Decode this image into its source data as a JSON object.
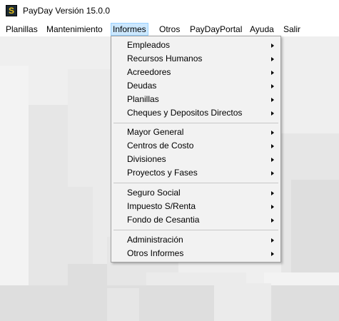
{
  "window": {
    "title": "PayDay Versión 15.0.0",
    "icon": "payday-logo-icon"
  },
  "menubar": {
    "items": [
      {
        "label": "Planillas"
      },
      {
        "label": "Mantenimiento"
      },
      {
        "label": "Informes",
        "active": true
      },
      {
        "label": "Otros"
      },
      {
        "label": "PayDayPortal"
      },
      {
        "label": "Ayuda"
      },
      {
        "label": "Salir"
      }
    ]
  },
  "informes_menu": {
    "groups": [
      [
        {
          "label": "Empleados",
          "submenu": true
        },
        {
          "label": "Recursos Humanos",
          "submenu": true
        },
        {
          "label": "Acreedores",
          "submenu": true
        },
        {
          "label": "Deudas",
          "submenu": true
        },
        {
          "label": "Planillas",
          "submenu": true
        },
        {
          "label": "Cheques y Depositos Directos",
          "submenu": true
        }
      ],
      [
        {
          "label": "Mayor General",
          "submenu": true
        },
        {
          "label": "Centros de Costo",
          "submenu": true
        },
        {
          "label": "Divisiones",
          "submenu": true
        },
        {
          "label": "Proyectos y Fases",
          "submenu": true
        }
      ],
      [
        {
          "label": "Seguro Social",
          "submenu": true
        },
        {
          "label": "Impuesto S/Renta",
          "submenu": true
        },
        {
          "label": "Fondo de Cesantia",
          "submenu": true
        }
      ],
      [
        {
          "label": "Administración",
          "submenu": true
        },
        {
          "label": "Otros Informes",
          "submenu": true
        }
      ]
    ]
  },
  "colors": {
    "menu_highlight": "#cce8ff",
    "menu_highlight_border": "#99d1ff",
    "dropdown_bg": "#f2f2f2",
    "workspace_bg": "#efefef"
  }
}
